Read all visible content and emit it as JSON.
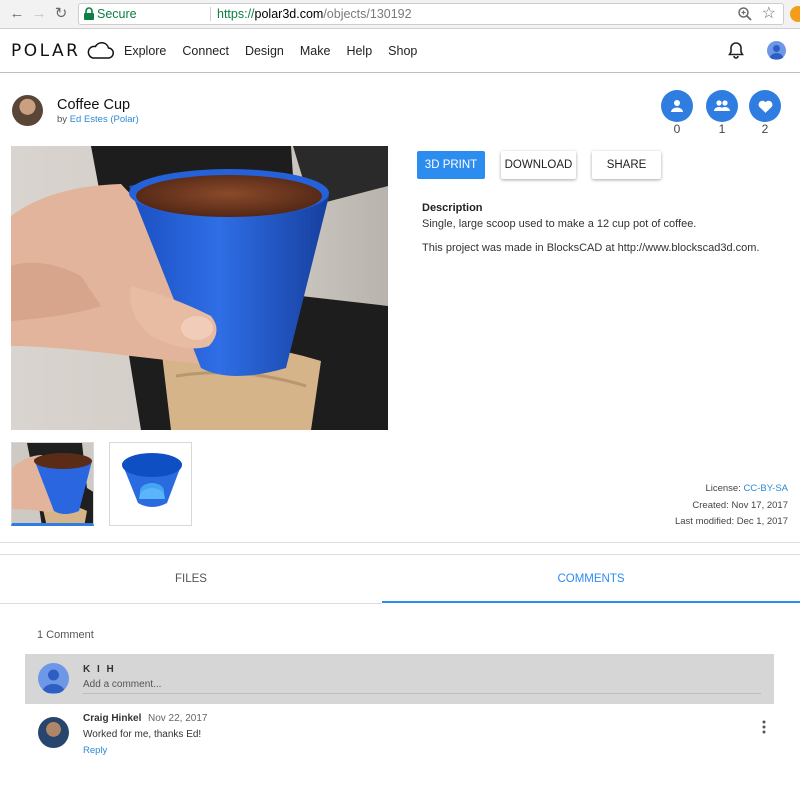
{
  "browser": {
    "secure_label": "Secure",
    "url_scheme": "https://",
    "url_domain": "polar3d.com",
    "url_path": "/objects/130192"
  },
  "header": {
    "logo_text": "POLAR",
    "nav": [
      "Explore",
      "Connect",
      "Design",
      "Make",
      "Help",
      "Shop"
    ]
  },
  "project": {
    "title": "Coffee Cup",
    "by_prefix": "by",
    "author": "Ed Estes (Polar)",
    "stats": [
      {
        "icon": "person-icon",
        "count": "0"
      },
      {
        "icon": "people-icon",
        "count": "1"
      },
      {
        "icon": "heart-icon",
        "count": "2"
      }
    ]
  },
  "actions": {
    "print_label": "3D PRINT",
    "download_label": "DOWNLOAD",
    "share_label": "SHARE"
  },
  "description": {
    "heading": "Description",
    "line1": "Single, large scoop used to make a 12 cup pot of coffee.",
    "line2": "This project was made in BlocksCAD at http://www.blockscad3d.com."
  },
  "meta": {
    "license_label": "License:",
    "license_value": "CC-BY-SA",
    "created": "Created: Nov 17, 2017",
    "modified": "Last modified: Dec 1, 2017"
  },
  "tabs": {
    "files": "FILES",
    "comments": "COMMENTS"
  },
  "comments": {
    "count_label": "1 Comment",
    "compose": {
      "user": "K I H",
      "placeholder": "Add a comment..."
    },
    "items": [
      {
        "author": "Craig Hinkel",
        "date": "Nov 22, 2017",
        "text": "Worked for me, thanks Ed!",
        "reply_label": "Reply"
      }
    ]
  },
  "colors": {
    "accent": "#2d8cf0",
    "stat_blue": "#2f7de1",
    "cup_blue": "#1f5fd6",
    "secure_green": "#0b8043"
  }
}
